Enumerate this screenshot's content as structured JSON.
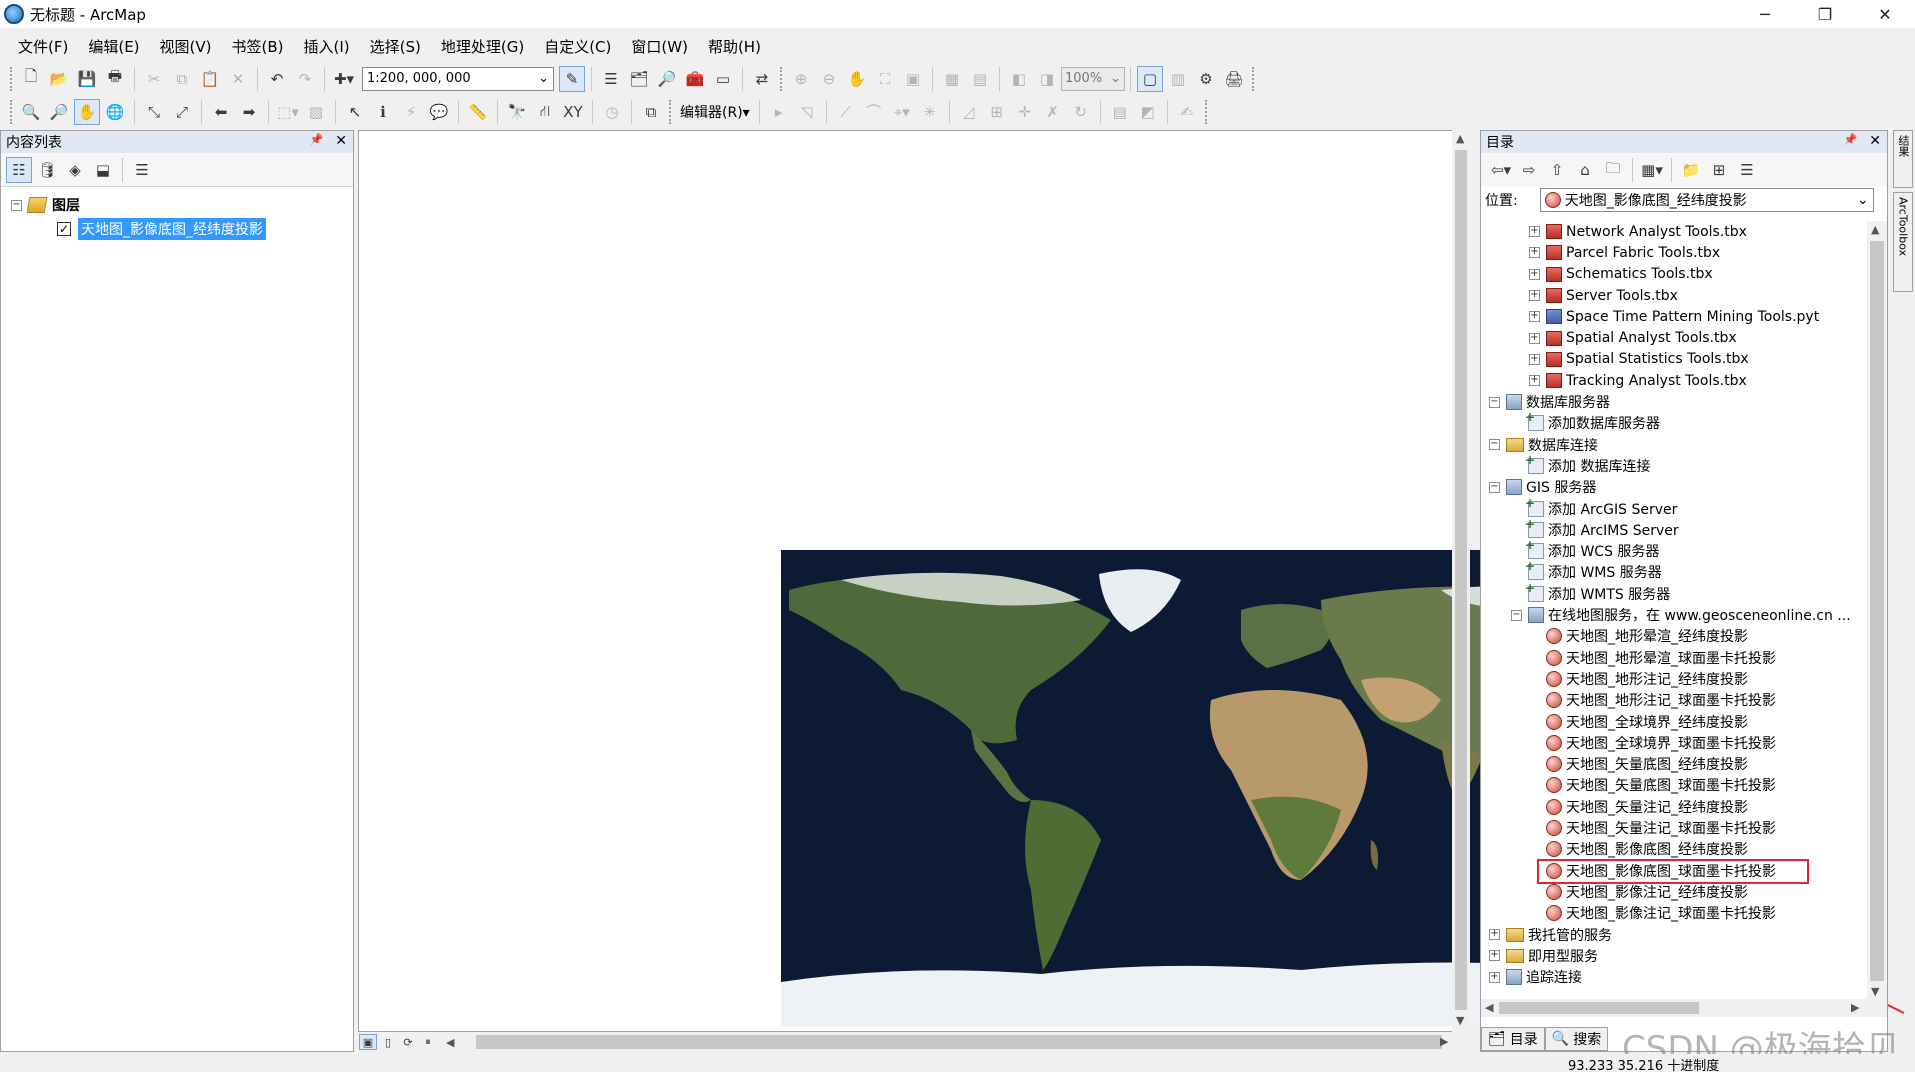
{
  "window": {
    "title": "无标题 - ArcMap",
    "minimize": "─",
    "restore": "❐",
    "close": "✕"
  },
  "menu": [
    "文件(F)",
    "编辑(E)",
    "视图(V)",
    "书签(B)",
    "插入(I)",
    "选择(S)",
    "地理处理(G)",
    "自定义(C)",
    "窗口(W)",
    "帮助(H)"
  ],
  "toolbar": {
    "scale_value": "1:200, 000, 000",
    "zoom_value": "100%",
    "editor_label": "编辑器(R)▾"
  },
  "toc": {
    "title": "内容列表",
    "pin": "📌",
    "close": "✕",
    "root_label": "图层",
    "layer_label": "天地图_影像底图_经纬度投影",
    "layer_checked": "✓"
  },
  "catalog": {
    "title": "目录",
    "pin": "📌",
    "close": "✕",
    "location_label": "位置:",
    "location_value": "天地图_影像底图_经纬度投影",
    "items": [
      {
        "text": "Network Analyst Tools.tbx",
        "icon": "toolbox-icon",
        "indent": 2
      },
      {
        "text": "Parcel Fabric Tools.tbx",
        "icon": "toolbox-icon",
        "indent": 2
      },
      {
        "text": "Schematics Tools.tbx",
        "icon": "toolbox-icon",
        "indent": 2
      },
      {
        "text": "Server Tools.tbx",
        "icon": "toolbox-icon",
        "indent": 2
      },
      {
        "text": "Space Time Pattern Mining Tools.pyt",
        "icon": "pytoolbox-icon",
        "indent": 2
      },
      {
        "text": "Spatial Analyst Tools.tbx",
        "icon": "toolbox-icon",
        "indent": 2
      },
      {
        "text": "Spatial Statistics Tools.tbx",
        "icon": "toolbox-icon",
        "indent": 2
      },
      {
        "text": "Tracking Analyst Tools.tbx",
        "icon": "toolbox-icon",
        "indent": 2
      },
      {
        "text": "数据库服务器",
        "icon": "server-icon",
        "indent": 0,
        "expander": "−"
      },
      {
        "text": "添加数据库服务器",
        "icon": "add-icon",
        "indent": 1
      },
      {
        "text": "数据库连接",
        "icon": "folder-icon",
        "indent": 0,
        "expander": "−"
      },
      {
        "text": "添加 数据库连接",
        "icon": "add-icon",
        "indent": 1
      },
      {
        "text": "GIS 服务器",
        "icon": "server-icon",
        "indent": 0,
        "expander": "−"
      },
      {
        "text": "添加 ArcGIS Server",
        "icon": "add-icon",
        "indent": 1
      },
      {
        "text": "添加 ArcIMS Server",
        "icon": "add-icon",
        "indent": 1
      },
      {
        "text": "添加 WCS 服务器",
        "icon": "add-icon",
        "indent": 1
      },
      {
        "text": "添加 WMS 服务器",
        "icon": "add-icon",
        "indent": 1
      },
      {
        "text": "添加 WMTS 服务器",
        "icon": "add-icon",
        "indent": 1
      },
      {
        "text": "在线地图服务，在 www.geosceneonline.cn ...",
        "icon": "server-icon",
        "indent": 1,
        "expander": "−"
      },
      {
        "text": "天地图_地形晕渲_经纬度投影",
        "icon": "service-icon",
        "indent": 2
      },
      {
        "text": "天地图_地形晕渲_球面墨卡托投影",
        "icon": "service-icon",
        "indent": 2
      },
      {
        "text": "天地图_地形注记_经纬度投影",
        "icon": "service-icon",
        "indent": 2
      },
      {
        "text": "天地图_地形注记_球面墨卡托投影",
        "icon": "service-icon",
        "indent": 2
      },
      {
        "text": "天地图_全球境界_经纬度投影",
        "icon": "service-icon",
        "indent": 2
      },
      {
        "text": "天地图_全球境界_球面墨卡托投影",
        "icon": "service-icon",
        "indent": 2
      },
      {
        "text": "天地图_矢量底图_经纬度投影",
        "icon": "service-icon",
        "indent": 2
      },
      {
        "text": "天地图_矢量底图_球面墨卡托投影",
        "icon": "service-icon",
        "indent": 2
      },
      {
        "text": "天地图_矢量注记_经纬度投影",
        "icon": "service-icon",
        "indent": 2
      },
      {
        "text": "天地图_矢量注记_球面墨卡托投影",
        "icon": "service-icon",
        "indent": 2
      },
      {
        "text": "天地图_影像底图_经纬度投影",
        "icon": "service-icon",
        "indent": 2
      },
      {
        "text": "天地图_影像底图_球面墨卡托投影",
        "icon": "service-icon",
        "indent": 2,
        "highlighted": true
      },
      {
        "text": "天地图_影像注记_经纬度投影",
        "icon": "service-icon",
        "indent": 2
      },
      {
        "text": "天地图_影像注记_球面墨卡托投影",
        "icon": "service-icon",
        "indent": 2
      },
      {
        "text": "我托管的服务",
        "icon": "folder-icon",
        "indent": 0,
        "expander": "+"
      },
      {
        "text": "即用型服务",
        "icon": "folder-icon",
        "indent": 0,
        "expander": "+"
      },
      {
        "text": "追踪连接",
        "icon": "server-icon",
        "indent": 0,
        "expander": "+"
      }
    ],
    "tab_catalog": "目录",
    "tab_search": "搜索"
  },
  "dock": {
    "results_tab": "结果",
    "arctoolbox_tab": "ArcToolbox"
  },
  "status": {
    "coords": "93.233  35.216 十进制度"
  },
  "watermark": "CSDN @极海拾贝",
  "colors": {
    "highlight_box": "#e0262e",
    "selection": "#3399ff",
    "panel_header": "#dfe8f3"
  }
}
